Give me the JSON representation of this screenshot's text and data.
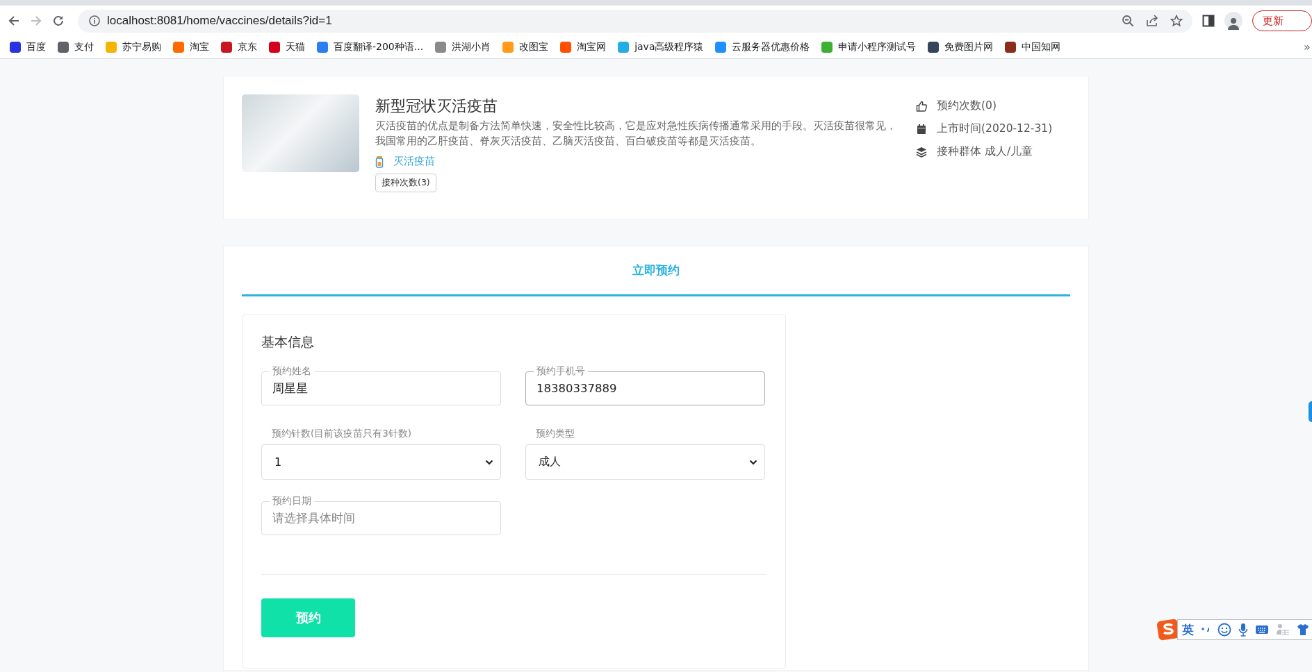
{
  "browser": {
    "back_disabled": false,
    "forward_disabled": true,
    "url": "localhost:8081/home/vaccines/details?id=1",
    "update_button": "更新",
    "bookmarks": [
      {
        "label": "百度",
        "color": "#2932e1"
      },
      {
        "label": "支付",
        "color": "#5f6368"
      },
      {
        "label": "苏宁易购",
        "color": "#f5b400"
      },
      {
        "label": "淘宝",
        "color": "#ff6a00"
      },
      {
        "label": "京东",
        "color": "#c91623"
      },
      {
        "label": "天猫",
        "color": "#d4001c"
      },
      {
        "label": "百度翻译-200种语...",
        "color": "#2a7ff0"
      },
      {
        "label": "洪湖小肖",
        "color": "#8a8a8a"
      },
      {
        "label": "改图宝",
        "color": "#ff9a1a"
      },
      {
        "label": "淘宝网",
        "color": "#ff5000"
      },
      {
        "label": "java高级程序猿",
        "color": "#23ade5"
      },
      {
        "label": "云服务器优惠价格",
        "color": "#1e90ff"
      },
      {
        "label": "申请小程序测试号",
        "color": "#3cb034"
      },
      {
        "label": "免费图片网",
        "color": "#35465c"
      },
      {
        "label": "中国知网",
        "color": "#8b2d1a"
      }
    ],
    "overflow": "»"
  },
  "vaccine": {
    "name": "新型冠状灭活疫苗",
    "description": "灭活疫苗的优点是制备方法简单快速，安全性比较高，它是应对急性疾病传播通常采用的手段。灭活疫苗很常见，我国常用的乙肝疫苗、脊灰灭活疫苗、乙脑灭活疫苗、百白破疫苗等都是灭活疫苗。",
    "category": "灭活疫苗",
    "dose_badge": "接种次数(3)",
    "stats": [
      {
        "kind": "likes",
        "text": "预约次数(0)"
      },
      {
        "kind": "calendar",
        "text": "上市时间(2020-12-31)"
      },
      {
        "kind": "layers",
        "text": "接种群体 成人/儿童"
      }
    ]
  },
  "tabs": [
    {
      "label": "立即预约",
      "selected": true
    }
  ],
  "form": {
    "title": "基本信息",
    "fields": [
      {
        "kind": "outlined",
        "label": "预约姓名",
        "value": "周星星",
        "focused": false
      },
      {
        "kind": "outlined",
        "label": "预约手机号",
        "value": "18380337889",
        "focused": true
      },
      {
        "kind": "select",
        "label": "预约针数(目前该疫苗只有3针数)",
        "value": "1",
        "focused": false
      },
      {
        "kind": "select",
        "label": "预约类型",
        "value": "成人",
        "focused": false
      },
      {
        "kind": "outlined",
        "label": "预约日期",
        "placeholder": "请选择具体时间",
        "focused": false
      }
    ],
    "submit": "预约"
  },
  "ime": {
    "mode": "英"
  }
}
